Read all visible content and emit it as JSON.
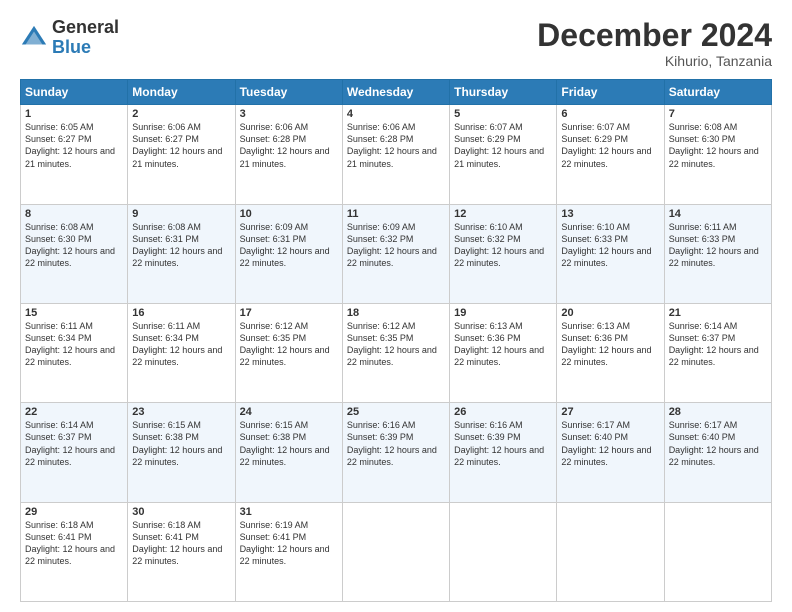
{
  "logo": {
    "general": "General",
    "blue": "Blue"
  },
  "header": {
    "month": "December 2024",
    "location": "Kihurio, Tanzania"
  },
  "days": [
    "Sunday",
    "Monday",
    "Tuesday",
    "Wednesday",
    "Thursday",
    "Friday",
    "Saturday"
  ],
  "weeks": [
    [
      {
        "day": "1",
        "sunrise": "6:05 AM",
        "sunset": "6:27 PM",
        "daylight": "12 hours and 21 minutes."
      },
      {
        "day": "2",
        "sunrise": "6:06 AM",
        "sunset": "6:27 PM",
        "daylight": "12 hours and 21 minutes."
      },
      {
        "day": "3",
        "sunrise": "6:06 AM",
        "sunset": "6:28 PM",
        "daylight": "12 hours and 21 minutes."
      },
      {
        "day": "4",
        "sunrise": "6:06 AM",
        "sunset": "6:28 PM",
        "daylight": "12 hours and 21 minutes."
      },
      {
        "day": "5",
        "sunrise": "6:07 AM",
        "sunset": "6:29 PM",
        "daylight": "12 hours and 21 minutes."
      },
      {
        "day": "6",
        "sunrise": "6:07 AM",
        "sunset": "6:29 PM",
        "daylight": "12 hours and 22 minutes."
      },
      {
        "day": "7",
        "sunrise": "6:08 AM",
        "sunset": "6:30 PM",
        "daylight": "12 hours and 22 minutes."
      }
    ],
    [
      {
        "day": "8",
        "sunrise": "6:08 AM",
        "sunset": "6:30 PM",
        "daylight": "12 hours and 22 minutes."
      },
      {
        "day": "9",
        "sunrise": "6:08 AM",
        "sunset": "6:31 PM",
        "daylight": "12 hours and 22 minutes."
      },
      {
        "day": "10",
        "sunrise": "6:09 AM",
        "sunset": "6:31 PM",
        "daylight": "12 hours and 22 minutes."
      },
      {
        "day": "11",
        "sunrise": "6:09 AM",
        "sunset": "6:32 PM",
        "daylight": "12 hours and 22 minutes."
      },
      {
        "day": "12",
        "sunrise": "6:10 AM",
        "sunset": "6:32 PM",
        "daylight": "12 hours and 22 minutes."
      },
      {
        "day": "13",
        "sunrise": "6:10 AM",
        "sunset": "6:33 PM",
        "daylight": "12 hours and 22 minutes."
      },
      {
        "day": "14",
        "sunrise": "6:11 AM",
        "sunset": "6:33 PM",
        "daylight": "12 hours and 22 minutes."
      }
    ],
    [
      {
        "day": "15",
        "sunrise": "6:11 AM",
        "sunset": "6:34 PM",
        "daylight": "12 hours and 22 minutes."
      },
      {
        "day": "16",
        "sunrise": "6:11 AM",
        "sunset": "6:34 PM",
        "daylight": "12 hours and 22 minutes."
      },
      {
        "day": "17",
        "sunrise": "6:12 AM",
        "sunset": "6:35 PM",
        "daylight": "12 hours and 22 minutes."
      },
      {
        "day": "18",
        "sunrise": "6:12 AM",
        "sunset": "6:35 PM",
        "daylight": "12 hours and 22 minutes."
      },
      {
        "day": "19",
        "sunrise": "6:13 AM",
        "sunset": "6:36 PM",
        "daylight": "12 hours and 22 minutes."
      },
      {
        "day": "20",
        "sunrise": "6:13 AM",
        "sunset": "6:36 PM",
        "daylight": "12 hours and 22 minutes."
      },
      {
        "day": "21",
        "sunrise": "6:14 AM",
        "sunset": "6:37 PM",
        "daylight": "12 hours and 22 minutes."
      }
    ],
    [
      {
        "day": "22",
        "sunrise": "6:14 AM",
        "sunset": "6:37 PM",
        "daylight": "12 hours and 22 minutes."
      },
      {
        "day": "23",
        "sunrise": "6:15 AM",
        "sunset": "6:38 PM",
        "daylight": "12 hours and 22 minutes."
      },
      {
        "day": "24",
        "sunrise": "6:15 AM",
        "sunset": "6:38 PM",
        "daylight": "12 hours and 22 minutes."
      },
      {
        "day": "25",
        "sunrise": "6:16 AM",
        "sunset": "6:39 PM",
        "daylight": "12 hours and 22 minutes."
      },
      {
        "day": "26",
        "sunrise": "6:16 AM",
        "sunset": "6:39 PM",
        "daylight": "12 hours and 22 minutes."
      },
      {
        "day": "27",
        "sunrise": "6:17 AM",
        "sunset": "6:40 PM",
        "daylight": "12 hours and 22 minutes."
      },
      {
        "day": "28",
        "sunrise": "6:17 AM",
        "sunset": "6:40 PM",
        "daylight": "12 hours and 22 minutes."
      }
    ],
    [
      {
        "day": "29",
        "sunrise": "6:18 AM",
        "sunset": "6:41 PM",
        "daylight": "12 hours and 22 minutes."
      },
      {
        "day": "30",
        "sunrise": "6:18 AM",
        "sunset": "6:41 PM",
        "daylight": "12 hours and 22 minutes."
      },
      {
        "day": "31",
        "sunrise": "6:19 AM",
        "sunset": "6:41 PM",
        "daylight": "12 hours and 22 minutes."
      },
      null,
      null,
      null,
      null
    ]
  ]
}
